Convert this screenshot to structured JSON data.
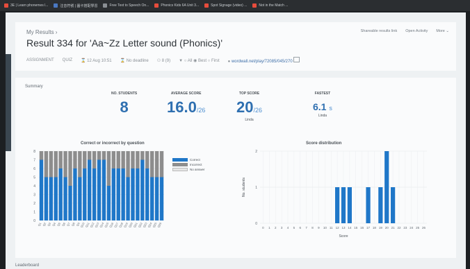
{
  "bookmarks": [
    {
      "label": "3E | Learn phonemes l...",
      "icon": "red"
    },
    {
      "label": "注音符號 | 圖卡搭配學習",
      "icon": "blue"
    },
    {
      "label": "Free Text to Speech On...",
      "icon": "gray"
    },
    {
      "label": "Phonics Kids 6A Unit 3...",
      "icon": "red"
    },
    {
      "label": "Spot Signage (video) ...",
      "icon": "red"
    },
    {
      "label": "Not in the Match ...",
      "icon": "red"
    }
  ],
  "header": {
    "breadcrumb": "My Results  ›",
    "title": "Result 334 for 'Aa~Zz Letter sound (Phonics)'",
    "actions": [
      "Shareable results link",
      "Open Activity",
      "More ⌄"
    ],
    "meta": {
      "assignment": "ASSIGNMENT",
      "type": "QUIZ",
      "date": "12 Aug 10:51",
      "deadline": "No deadline",
      "players": "8 (9)",
      "filter_all": "All",
      "filter_best": "Best",
      "filter_first": "First",
      "url": "wordwall.net/play/72085/045/270"
    }
  },
  "summary": {
    "label": "Summary",
    "students": {
      "label": "NO. STUDENTS",
      "value": "8"
    },
    "average": {
      "label": "AVERAGE SCORE",
      "value": "16.0",
      "den": "/26"
    },
    "top": {
      "label": "TOP SCORE",
      "value": "20",
      "den": "/26",
      "who": "Linda"
    },
    "fastest": {
      "label": "FASTEST",
      "value": "6.1",
      "unit": "s",
      "who": "Linda"
    }
  },
  "colors": {
    "correct": "#1f77c8",
    "incorrect": "#8d8d8d",
    "noanswer": "#e6e6e6"
  },
  "chart_data": [
    {
      "type": "bar",
      "title": "Correct or incorrect by question",
      "ylim": [
        0,
        8
      ],
      "yticks": [
        "0",
        "1",
        "2",
        "3",
        "4",
        "5",
        "6",
        "7",
        "8"
      ],
      "categories": [
        "Q1",
        "Q2",
        "Q3",
        "Q4",
        "Q5",
        "Q6",
        "Q7",
        "Q8",
        "Q9",
        "Q10",
        "Q11",
        "Q12",
        "Q13",
        "Q14",
        "Q15",
        "Q16",
        "Q17",
        "Q18",
        "Q19",
        "Q20",
        "Q21",
        "Q22",
        "Q23",
        "Q24",
        "Q25",
        "Q26"
      ],
      "series": [
        {
          "name": "Correct",
          "values": [
            7,
            5,
            5,
            5,
            6,
            5,
            4,
            6,
            5,
            6,
            7,
            6,
            7,
            7,
            4,
            6,
            6,
            6,
            5,
            6,
            6,
            7,
            6,
            5,
            5,
            5
          ]
        },
        {
          "name": "Incorrect",
          "values": [
            1,
            3,
            3,
            3,
            2,
            3,
            4,
            2,
            3,
            2,
            1,
            2,
            1,
            1,
            4,
            2,
            2,
            2,
            3,
            2,
            2,
            1,
            2,
            3,
            3,
            3
          ]
        },
        {
          "name": "No answer",
          "values": [
            0,
            0,
            0,
            0,
            0,
            0,
            0,
            0,
            0,
            0,
            0,
            0,
            0,
            0,
            0,
            0,
            0,
            0,
            0,
            0,
            0,
            0,
            0,
            0,
            0,
            0
          ]
        }
      ]
    },
    {
      "type": "bar",
      "title": "Score distribution",
      "xlabel": "Score",
      "ylabel": "No. students",
      "ylim": [
        0,
        2
      ],
      "yticks": [
        "0",
        "1",
        "2"
      ],
      "categories": [
        "0",
        "1",
        "2",
        "3",
        "4",
        "5",
        "6",
        "7",
        "8",
        "9",
        "10",
        "11",
        "12",
        "13",
        "14",
        "15",
        "16",
        "17",
        "18",
        "19",
        "20",
        "21",
        "22",
        "23",
        "24",
        "25",
        "26"
      ],
      "values": [
        0,
        0,
        0,
        0,
        0,
        0,
        0,
        0,
        0,
        0,
        0,
        0,
        1,
        1,
        1,
        0,
        0,
        1,
        0,
        1,
        2,
        1,
        0,
        0,
        0,
        0,
        0
      ]
    }
  ],
  "leaderboard": {
    "label": "Leaderboard"
  }
}
